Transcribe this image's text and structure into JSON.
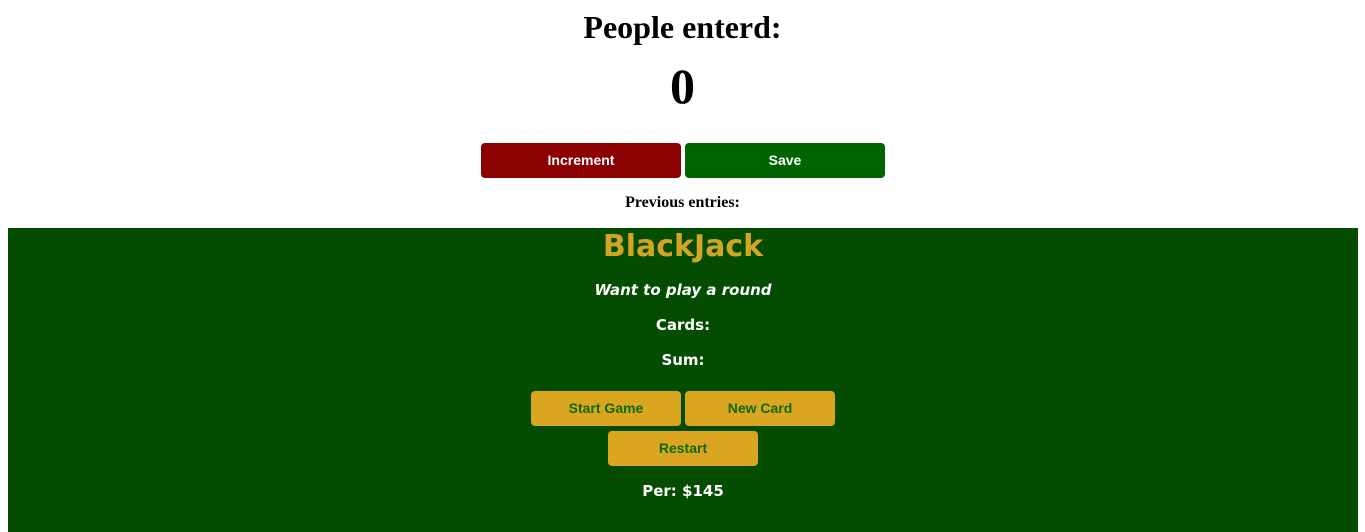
{
  "counter": {
    "title": "People enterd:",
    "value": "0",
    "increment_label": "Increment",
    "save_label": "Save",
    "previous_entries": "Previous entries:"
  },
  "game": {
    "title": "BlackJack",
    "message": "Want to play a round",
    "cards_label": "Cards:",
    "sum_label": "Sum:",
    "start_label": "Start Game",
    "new_card_label": "New Card",
    "restart_label": "Restart",
    "player": "Per: $145"
  },
  "colors": {
    "increment": "#8b0000",
    "save": "#006400",
    "table": "#044d00",
    "title_gold": "#d4a524",
    "button_gold": "#daa520",
    "button_text": "#0d6b06"
  }
}
